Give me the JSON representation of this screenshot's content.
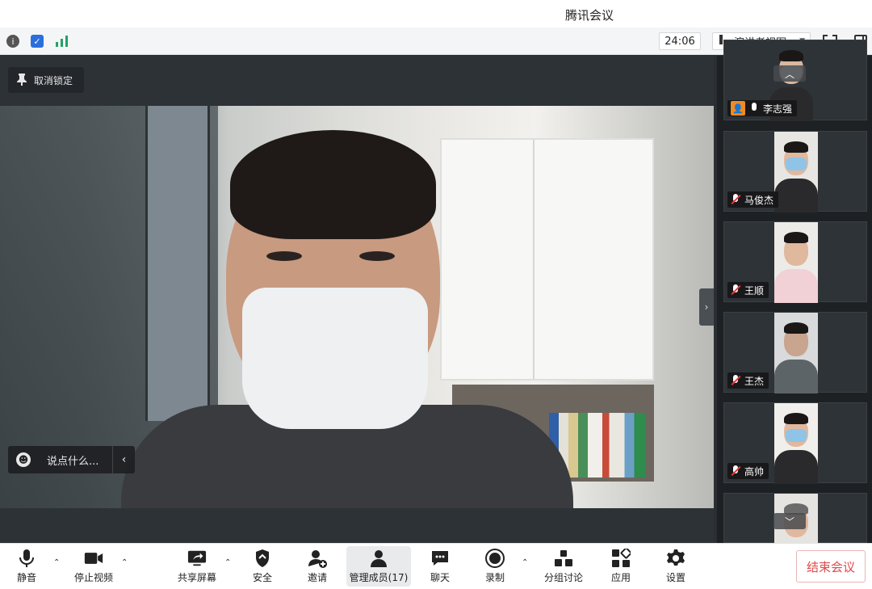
{
  "window": {
    "title": "腾讯会议"
  },
  "statusbar": {
    "info_icon": "info-icon",
    "shield_icon": "shield-icon",
    "signal_icon": "signal-bars-icon",
    "timer": "24:06",
    "view_mode": "演讲者视图",
    "fullscreen_icon": "fullscreen-icon",
    "sidebar_icon": "sidebar-toggle-icon"
  },
  "main": {
    "unpin_label": "取消锁定",
    "chat_placeholder": "说点什么..."
  },
  "gallery": {
    "participants": [
      {
        "name": "李志强",
        "muted": false
      },
      {
        "name": "马俊杰",
        "muted": true
      },
      {
        "name": "王顺",
        "muted": true
      },
      {
        "name": "王杰",
        "muted": true
      },
      {
        "name": "高帅",
        "muted": true
      }
    ]
  },
  "toolbar": {
    "items": [
      {
        "label": "静音",
        "icon": "microphone-icon"
      },
      {
        "label": "停止视频",
        "icon": "video-camera-icon"
      },
      {
        "label": "共享屏幕",
        "icon": "share-screen-icon"
      },
      {
        "label": "安全",
        "icon": "security-shield-icon"
      },
      {
        "label": "邀请",
        "icon": "invite-user-icon"
      },
      {
        "label": "管理成员(17)",
        "icon": "members-icon"
      },
      {
        "label": "聊天",
        "icon": "chat-icon"
      },
      {
        "label": "录制",
        "icon": "record-icon"
      },
      {
        "label": "分组讨论",
        "icon": "breakout-icon"
      },
      {
        "label": "应用",
        "icon": "apps-icon"
      },
      {
        "label": "设置",
        "icon": "gear-icon"
      }
    ],
    "end_label": "结束会议"
  },
  "colors": {
    "accent_green": "#21a366",
    "end_red": "#e04a4a",
    "badge_orange": "#f08a24"
  }
}
